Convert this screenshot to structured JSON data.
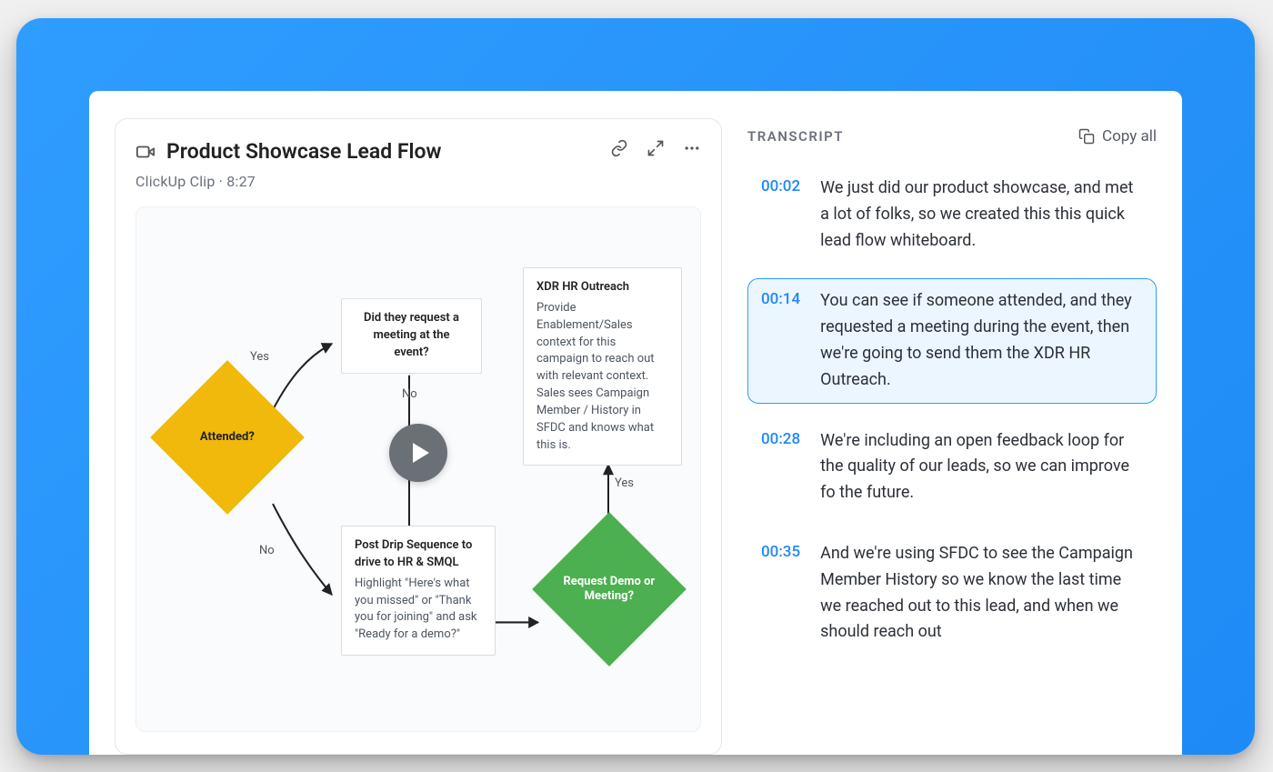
{
  "video": {
    "title": "Product Showcase Lead Flow",
    "subtitle": "ClickUp Clip · 8:27",
    "icon": "video-camera-icon",
    "actions": {
      "link": "link-icon",
      "expand": "expand-icon",
      "more": "more-icon"
    },
    "play_label": "Play"
  },
  "flow": {
    "attended_label": "Attended?",
    "yes": "Yes",
    "no": "No",
    "meeting_box": "Did they request a meeting at the event?",
    "xdr_title": "XDR HR Outreach",
    "xdr_body": "Provide Enablement/Sales context for this campaign to reach out with relevant context. Sales sees Campaign Member / History in SFDC and knows what this is.",
    "drip_title": "Post Drip Sequence to drive to HR & SMQL",
    "drip_body": "Highlight \"Here's what you missed\" or \"Thank you for joining\" and ask \"Ready for a demo?\"",
    "demo_label": "Request Demo or Meeting?"
  },
  "transcript": {
    "heading": "TRANSCRIPT",
    "copy_all": "Copy all",
    "items": [
      {
        "time": "00:02",
        "text": "We just did our product showcase, and met a lot of folks, so we created this this quick lead flow whiteboard.",
        "active": false
      },
      {
        "time": "00:14",
        "text": "You can see if someone attended, and they requested a meeting during the event, then we're going to send them the XDR HR Outreach.",
        "active": true
      },
      {
        "time": "00:28",
        "text": "We're including an open feedback loop for the quality of our leads, so we can improve fo the future.",
        "active": false
      },
      {
        "time": "00:35",
        "text": "And we're using SFDC to see the Campaign Member History so we know the last time we reached out to this lead, and when we should reach out",
        "active": false
      }
    ]
  }
}
